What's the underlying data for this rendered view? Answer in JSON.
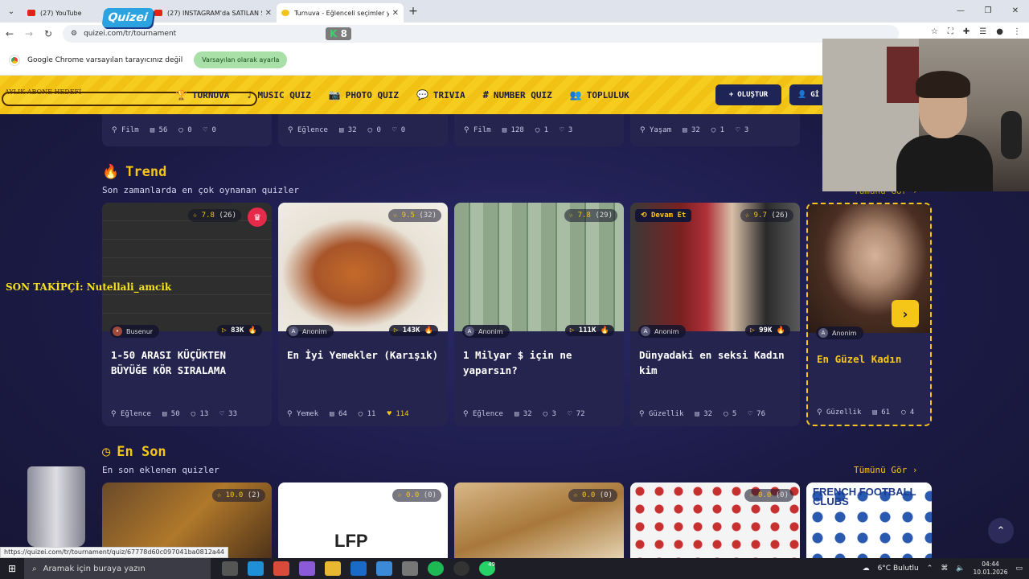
{
  "browser": {
    "tabs": [
      {
        "title": "(27) YouTube",
        "favicon": "youtube-icon"
      },
      {
        "title": "(27) INSTAGRAM'da SATILAN S...",
        "favicon": "youtube-icon"
      },
      {
        "title": "Turnuva - Eğlenceli seçimler ya...",
        "favicon": "quizei-icon"
      }
    ],
    "url": "quizei.com/tr/tournament",
    "ext_badge": "8",
    "infobar_message": "Google Chrome varsayılan tarayıcınız değil",
    "infobar_button": "Varsayılan olarak ayarla"
  },
  "site": {
    "logo_text": "Quizei",
    "overlay_label": "AYLIK ABONE HEDEFİ",
    "nav": [
      {
        "label": "TURNUVA",
        "icon": "trophy-icon"
      },
      {
        "label": "MUSIC QUIZ",
        "icon": "music-note-icon"
      },
      {
        "label": "PHOTO QUIZ",
        "icon": "camera-icon"
      },
      {
        "label": "TRIVIA",
        "icon": "chat-bubble-icon"
      },
      {
        "label": "NUMBER QUIZ",
        "icon": "hash-icon"
      },
      {
        "label": "TOPLULUK",
        "icon": "users-icon"
      }
    ],
    "create_button": "OLUŞTUR",
    "login_button": "Gİ"
  },
  "previous_row": [
    {
      "category": "Film",
      "questions": "56",
      "comments": "0",
      "likes": "0"
    },
    {
      "category": "Eğlence",
      "questions": "32",
      "comments": "0",
      "likes": "0"
    },
    {
      "category": "Film",
      "questions": "128",
      "comments": "1",
      "likes": "3"
    },
    {
      "category": "Yaşam",
      "questions": "32",
      "comments": "1",
      "likes": "3"
    }
  ],
  "trend": {
    "title": "Trend",
    "subtitle": "Son zamanlarda en çok oynanan quizler",
    "see_all": "Tümünü Gör",
    "cards": [
      {
        "rating": "7.8",
        "votes": "(26)",
        "author": "Busenur",
        "plays": "83K",
        "title": "1-50 ARASI KÜÇÜKTEN BÜYÜĞE KÖR SIRALAMA",
        "category": "Eğlence",
        "questions": "50",
        "comments": "13",
        "likes": "33"
      },
      {
        "rating": "9.5",
        "votes": "(32)",
        "author": "Anonim",
        "plays": "143K",
        "title": "En İyi Yemekler (Karışık)",
        "category": "Yemek",
        "questions": "64",
        "comments": "11",
        "likes": "114"
      },
      {
        "rating": "7.8",
        "votes": "(29)",
        "author": "Anonim",
        "plays": "111K",
        "title": "1 Milyar $ için ne yaparsın?",
        "category": "Eğlence",
        "questions": "32",
        "comments": "3",
        "likes": "72"
      },
      {
        "rating": "9.7",
        "votes": "(26)",
        "author": "Anonim",
        "plays": "99K",
        "title": "Dünyadaki en seksi Kadın kim",
        "category": "Güzellik",
        "questions": "32",
        "comments": "5",
        "likes": "76",
        "badge": "Devam Et"
      },
      {
        "author": "Anonim",
        "title": "En Güzel Kadın",
        "category": "Güzellik",
        "questions": "61",
        "comments": "4"
      }
    ]
  },
  "recent": {
    "title": "En Son",
    "subtitle": "En son eklenen quizler",
    "see_all": "Tümünü Gör",
    "cards": [
      {
        "rating": "10.0",
        "votes": "(2)"
      },
      {
        "rating": "0.0",
        "votes": "(0)",
        "logo_text": "LFP"
      },
      {
        "rating": "0.0",
        "votes": "(0)"
      },
      {
        "rating": "0.0",
        "votes": "(0)"
      },
      {
        "logo_text": "FRENCH FOOTBALL CLUBS"
      }
    ]
  },
  "stream_overlay": {
    "last_follower": "SON TAKİPÇİ: Nutellali_amcik"
  },
  "status_url": "https://quizei.com/tr/tournament/quiz/67778d60c097041ba0812a44",
  "taskbar": {
    "search_placeholder": "Aramak için buraya yazın",
    "weather": "6°C Bulutlu",
    "time": "04:44",
    "date": "10.01.2026",
    "whatsapp_badge": "49"
  }
}
